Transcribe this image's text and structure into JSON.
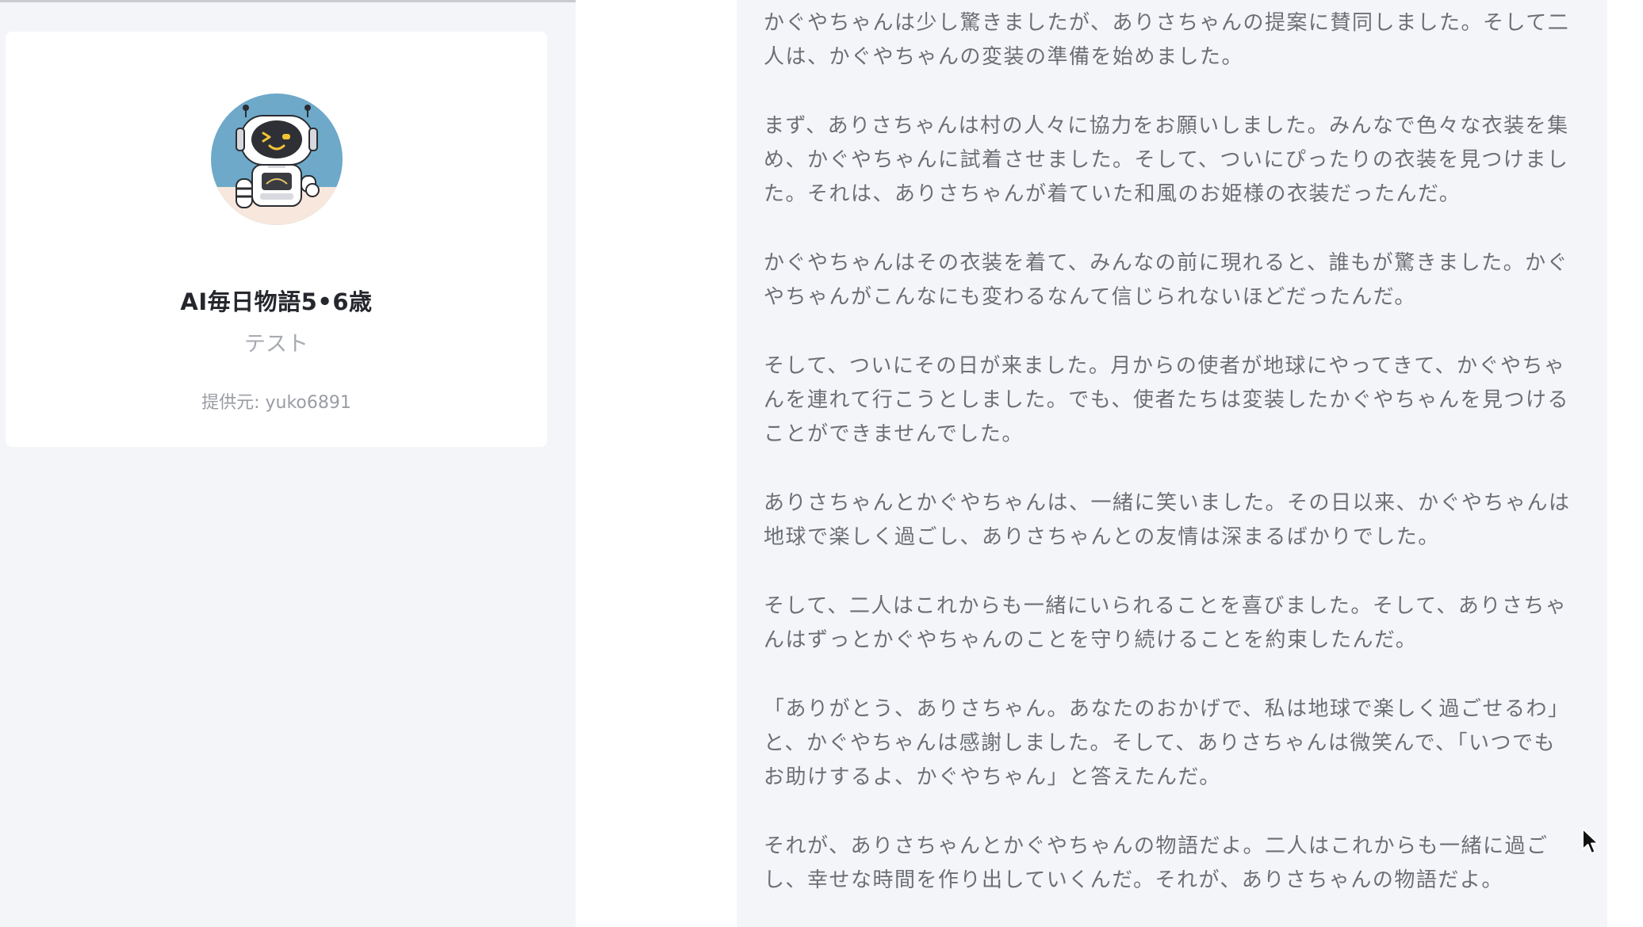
{
  "profile": {
    "avatar_icon": "robot-avatar-icon",
    "name": "AI毎日物語5•6歳",
    "description": "テスト",
    "provider": "提供元: yuko6891"
  },
  "message": {
    "paragraphs": [
      "かぐやちゃんは少し驚きましたが、ありさちゃんの提案に賛同しました。そして二\n人は、かぐやちゃんの変装の準備を始めました。",
      "まず、ありさちゃんは村の人々に協力をお願いしました。みんなで色々な衣装を集\nめ、かぐやちゃんに試着させました。そして、ついにぴったりの衣装を見つけまし\nた。それは、ありさちゃんが着ていた和風のお姫様の衣装だったんだ。",
      "かぐやちゃんはその衣装を着て、みんなの前に現れると、誰もが驚きました。かぐ\nやちゃんがこんなにも変わるなんて信じられないほどだったんだ。",
      "そして、ついにその日が来ました。月からの使者が地球にやってきて、かぐやちゃ\nんを連れて行こうとしました。でも、使者たちは変装したかぐやちゃんを見つける\nことができませんでした。",
      "ありさちゃんとかぐやちゃんは、一緒に笑いました。その日以来、かぐやちゃんは\n地球で楽しく過ごし、ありさちゃんとの友情は深まるばかりでした。",
      "そして、二人はこれからも一緒にいられることを喜びました。そして、ありさちゃ\nんはずっとかぐやちゃんのことを守り続けることを約束したんだ。",
      "「ありがとう、ありさちゃん。あなたのおかげで、私は地球で楽しく過ごせるわ」\nと、かぐやちゃんは感謝しました。そして、ありさちゃんは微笑んで、「いつでも\nお助けするよ、かぐやちゃん」と答えたんだ。",
      "それが、ありさちゃんとかぐやちゃんの物語だよ。二人はこれからも一緒に過ご\nし、幸せな時間を作り出していくんだ。それが、ありさちゃんの物語だよ。"
    ]
  },
  "cursor_icon": "mouse-pointer-icon",
  "colors": {
    "page_background": "#f4f5f9",
    "card_background": "#ffffff",
    "message_text": "#6c6f75",
    "avatar_background": "#6ea9c9"
  }
}
